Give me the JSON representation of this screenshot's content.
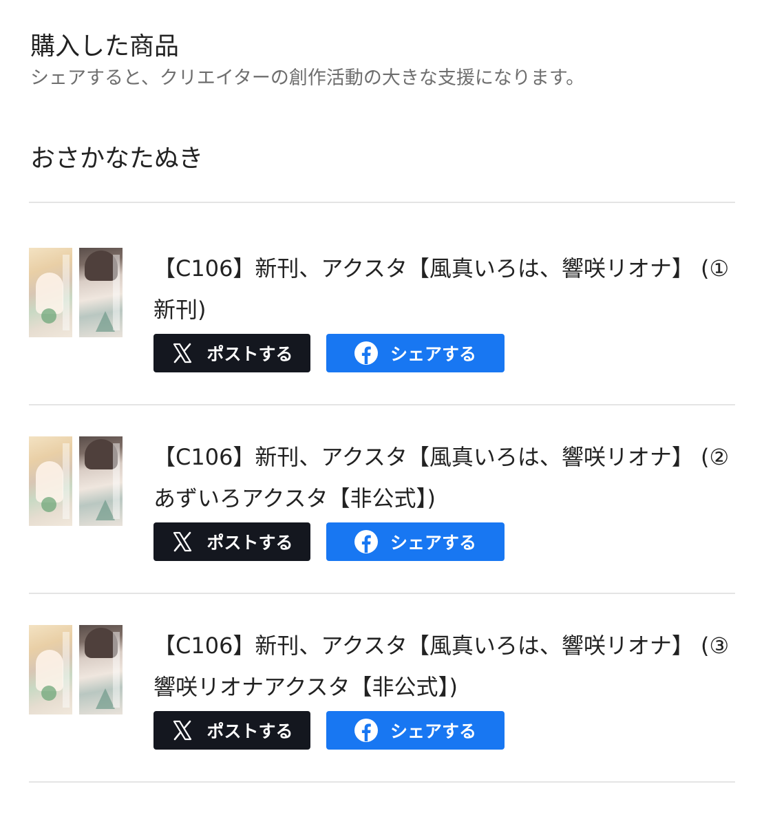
{
  "header": {
    "title": "購入した商品",
    "subtitle": "シェアすると、クリエイターの創作活動の大きな支援になります。"
  },
  "creator": {
    "name": "おさかなたぬき"
  },
  "items": [
    {
      "title": "【C106】新刊、アクスタ【風真いろは、響咲リオナ】 (①新刊)",
      "post_label": "ポストする",
      "share_label": "シェアする"
    },
    {
      "title": "【C106】新刊、アクスタ【風真いろは、響咲リオナ】 (②あずいろアクスタ【非公式】)",
      "post_label": "ポストする",
      "share_label": "シェアする"
    },
    {
      "title": "【C106】新刊、アクスタ【風真いろは、響咲リオナ】 (③響咲リオナアクスタ【非公式】)",
      "post_label": "ポストする",
      "share_label": "シェアする"
    }
  ],
  "icons": {
    "post": "x-logo-icon",
    "share": "facebook-icon"
  },
  "colors": {
    "x_button": "#14171f",
    "facebook_button": "#1877f2",
    "divider": "#e4e4e4",
    "subtitle_text": "#6e6e6e"
  }
}
